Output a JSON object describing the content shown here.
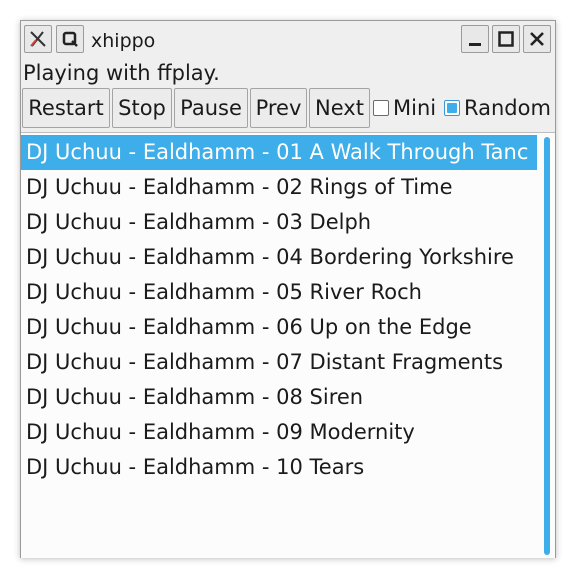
{
  "window": {
    "title": "xhippo",
    "icons": [
      "xhippo-app-icon",
      "keep-above-icon",
      "minimize-icon",
      "maximize-icon",
      "close-icon"
    ]
  },
  "status": "Playing with ffplay.",
  "toolbar": {
    "restart_label": "Restart",
    "stop_label": "Stop",
    "pause_label": "Pause",
    "prev_label": "Prev",
    "next_label": "Next",
    "mini_label": "Mini",
    "mini_checked": false,
    "random_label": "Random",
    "random_checked": true
  },
  "playlist": {
    "selected_index": 0,
    "items": [
      "DJ Uchuu - Ealdhamm - 01 A Walk Through Tanc",
      "DJ Uchuu - Ealdhamm - 02 Rings of Time",
      "DJ Uchuu - Ealdhamm - 03 Delph",
      "DJ Uchuu - Ealdhamm - 04 Bordering Yorkshire",
      "DJ Uchuu - Ealdhamm - 05 River Roch",
      "DJ Uchuu - Ealdhamm - 06 Up on the Edge",
      "DJ Uchuu - Ealdhamm - 07 Distant Fragments",
      "DJ Uchuu - Ealdhamm - 08 Siren",
      "DJ Uchuu - Ealdhamm - 09 Modernity",
      "DJ Uchuu - Ealdhamm - 10 Tears"
    ]
  },
  "colors": {
    "accent": "#3daee9",
    "text": "#1b1b1b",
    "window_bg": "#efefef"
  }
}
